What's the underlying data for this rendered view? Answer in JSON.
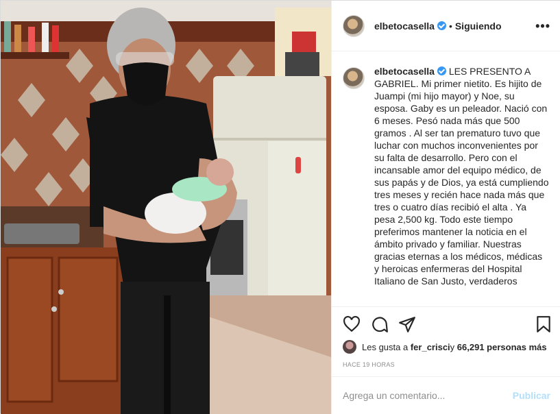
{
  "header": {
    "username": "elbetocasella",
    "dot": "•",
    "follow_label": "Siguiendo",
    "more_label": "•••"
  },
  "caption": {
    "username": "elbetocasella",
    "text": "LES PRESENTO A GABRIEL. Mi primer nietito. Es hijito de Juampi (mi hijo mayor) y Noe, su esposa. Gaby es un peleador. Nació con 6 meses. Pesó nada más que 500 gramos . Al ser tan prematuro tuvo que luchar con muchos inconvenientes por su falta de desarrollo. Pero con el incansable amor del equipo médico, de sus papás y de Dios, ya está cumpliendo tres meses y recién hace nada más que tres o cuatro días recibió el alta . Ya pesa 2,500 kg. Todo este tiempo preferimos mantener la noticia en el ámbito privado y familiar. Nuestras gracias eternas a los médicos, médicas y heroicas enfermeras del Hospital Italiano de San Justo, verdaderos"
  },
  "likes": {
    "prefix": "Les gusta a ",
    "user": "fer_crisci",
    "middle": " y ",
    "count": "66,291 personas más"
  },
  "timestamp": "HACE 19 HORAS",
  "comment": {
    "placeholder": "Agrega un comentario...",
    "post_label": "Publicar"
  },
  "colors": {
    "verified": "#3897f0",
    "publish_disabled": "#b2dffc"
  }
}
